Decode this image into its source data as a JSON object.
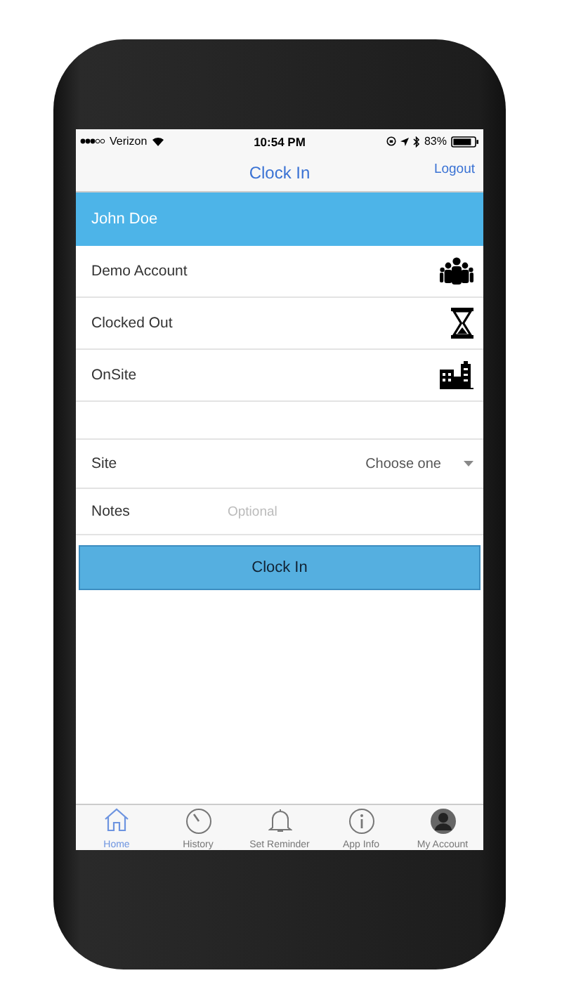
{
  "status_bar": {
    "carrier": "Verizon",
    "time": "10:54 PM",
    "battery": "83%"
  },
  "nav_bar": {
    "title": "Clock In",
    "action": "Logout"
  },
  "user_header": "John Doe",
  "info_rows": [
    {
      "label": "Demo Account",
      "kind": "people"
    },
    {
      "label": "Clocked Out",
      "kind": "hourglass"
    },
    {
      "label": "OnSite",
      "kind": "buildings"
    }
  ],
  "form": {
    "site": {
      "label": "Site",
      "value": "Choose one"
    },
    "notes": {
      "label": "Notes",
      "placeholder": "Optional"
    }
  },
  "clock_in_button": "Clock In",
  "tabs": [
    {
      "label": "Home",
      "kind": "home",
      "selected": true
    },
    {
      "label": "History",
      "kind": "history",
      "selected": false
    },
    {
      "label": "Set Reminder",
      "kind": "bell",
      "selected": false
    },
    {
      "label": "App Info",
      "kind": "info",
      "selected": false
    },
    {
      "label": "My Account",
      "kind": "account",
      "selected": false
    }
  ]
}
